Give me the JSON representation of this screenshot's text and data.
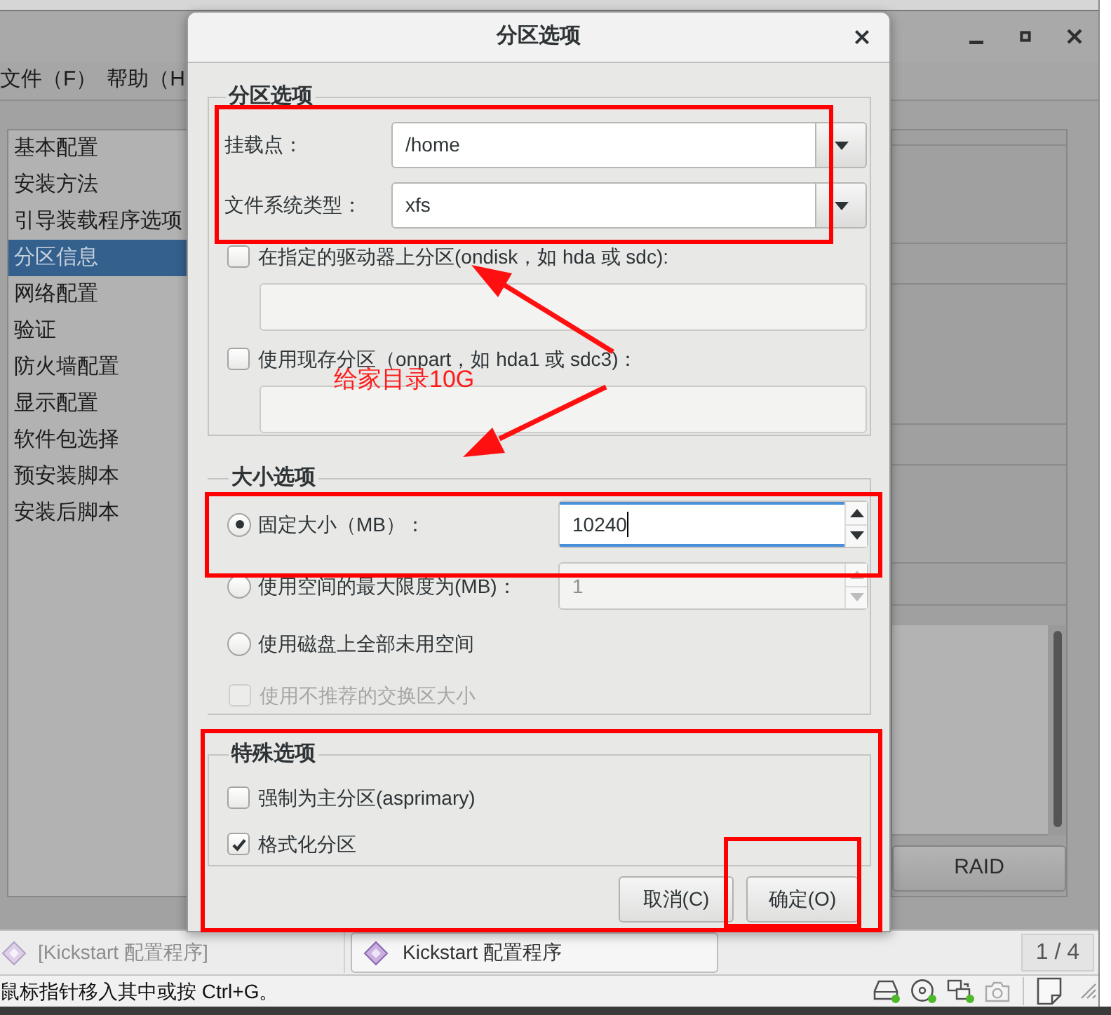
{
  "main_window": {
    "menu": [
      {
        "label": "文件（F）"
      },
      {
        "label": "帮助（H"
      }
    ],
    "sidebar": [
      {
        "label": "基本配置",
        "selected": false
      },
      {
        "label": "安装方法",
        "selected": false
      },
      {
        "label": "引导装载程序选项",
        "selected": false
      },
      {
        "label": "分区信息",
        "selected": true
      },
      {
        "label": "网络配置",
        "selected": false
      },
      {
        "label": "验证",
        "selected": false
      },
      {
        "label": "防火墙配置",
        "selected": false
      },
      {
        "label": "显示配置",
        "selected": false
      },
      {
        "label": "软件包选择",
        "selected": false
      },
      {
        "label": "预安装脚本",
        "selected": false
      },
      {
        "label": "安装后脚本",
        "selected": false
      }
    ],
    "buttons": [
      {
        "label": "RAID"
      }
    ]
  },
  "dialog": {
    "title": "分区选项",
    "partition_options": {
      "title": "分区选项",
      "fields": [
        {
          "label": "挂载点：",
          "value": "/home"
        },
        {
          "label": "文件系统类型：",
          "value": "xfs"
        }
      ],
      "checkbox_fields": [
        {
          "label": "在指定的驱动器上分区(ondisk，如 hda 或 sdc):",
          "checked": false
        },
        {
          "label": "使用现存分区（onpart，如 hda1 或 sdc3)：",
          "checked": false
        }
      ]
    },
    "size_options": {
      "title": "大小选项",
      "choices": [
        {
          "kind": "spin",
          "label": "固定大小（MB）：",
          "selected": true,
          "value": "10240",
          "spin_disabled": false,
          "focused": true
        },
        {
          "kind": "spin",
          "label": "使用空间的最大限度为(MB)：",
          "selected": false,
          "value": "1",
          "spin_disabled": true,
          "focused": false
        },
        {
          "kind": "radio",
          "label": "使用磁盘上全部未用空间",
          "selected": false
        }
      ],
      "swap": {
        "label": "使用不推荐的交换区大小",
        "checked": false,
        "disabled": true
      }
    },
    "special_options": {
      "title": "特殊选项",
      "checkboxes": [
        {
          "label": "强制为主分区(asprimary)",
          "checked": false
        },
        {
          "label": "格式化分区",
          "checked": true
        }
      ]
    },
    "buttons": [
      {
        "label": "取消(C)"
      },
      {
        "label": "确定(O)"
      }
    ]
  },
  "annotation": {
    "text": "给家目录10G"
  },
  "taskbar": {
    "items": [
      {
        "label": "[Kickstart 配置程序]",
        "minimized": true
      },
      {
        "label": "Kickstart 配置程序",
        "minimized": false
      }
    ],
    "pager": "1 / 4"
  },
  "status_bar": {
    "message": "鼠标指针移入其中或按 Ctrl+G。"
  }
}
